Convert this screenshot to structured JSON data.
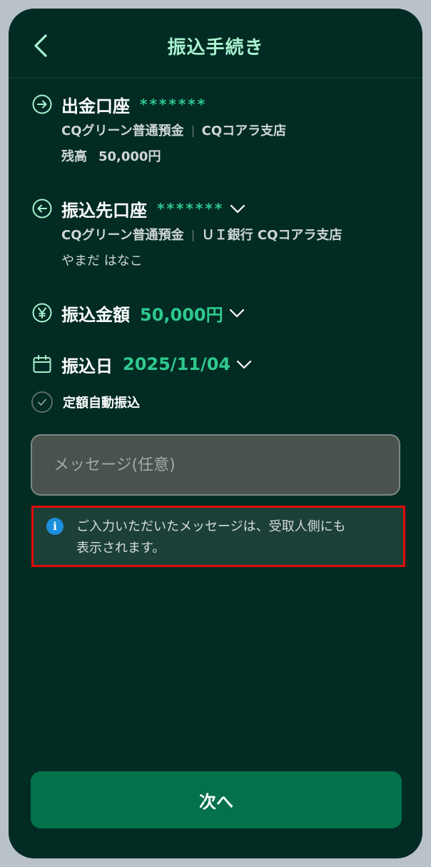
{
  "header": {
    "title": "振込手続き"
  },
  "from_account": {
    "label": "出金口座",
    "masked_number": "*******",
    "account_type": "CQグリーン普通預金",
    "branch": "CQコアラ支店",
    "balance_label": "残高",
    "balance_value": "50,000円"
  },
  "to_account": {
    "label": "振込先口座",
    "masked_number": "*******",
    "account_type": "CQグリーン普通預金",
    "branch": "ＵＩ銀行 CQコアラ支店",
    "holder_name": "やまだ はなこ"
  },
  "amount": {
    "label": "振込金額",
    "value": "50,000円"
  },
  "transfer_date": {
    "label": "振込日",
    "value": "2025/11/04"
  },
  "recurring": {
    "label": "定額自動振込"
  },
  "message": {
    "placeholder": "メッセージ(任意)",
    "value": ""
  },
  "notice": {
    "line1": "ご入力いただいたメッセージは、受取人側にも",
    "line2": "表示されます。"
  },
  "next_button": {
    "label": "次へ"
  },
  "colors": {
    "background": "#022b24",
    "accent": "#2fc98e",
    "title": "#a8f2cf",
    "button": "#04714b",
    "info": "#1c8fdc"
  }
}
